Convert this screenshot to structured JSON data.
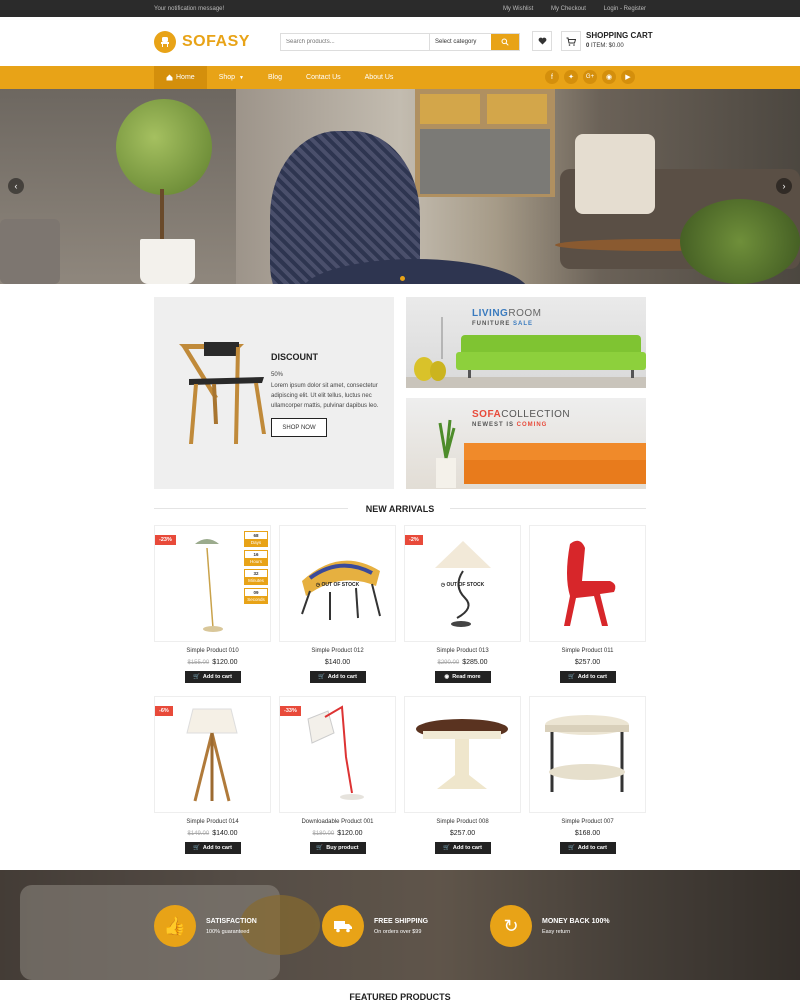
{
  "topbar": {
    "notification": "Your notification message!",
    "links": [
      "My Wishlist",
      "My Checkout",
      "Login - Register"
    ]
  },
  "logo": {
    "text": "SOFASY"
  },
  "search": {
    "placeholder": "Search products...",
    "category": "Select category"
  },
  "cart": {
    "title": "SHOPPING CART",
    "count": "0",
    "summary": "ITEM: $0.00"
  },
  "nav": {
    "items": [
      "Home",
      "Shop",
      "Blog",
      "Contact Us",
      "About Us"
    ],
    "social": [
      "f",
      "t",
      "G+",
      "ig",
      "yt"
    ]
  },
  "discount": {
    "title": "DISCOUNT",
    "percent": "50%",
    "text": "Lorem ipsum dolor sit amet, consectetur adipiscing elit. Ut elit tellus, luctus nec ullamcorper mattis, pulvinar dapibus leo.",
    "button": "SHOP NOW"
  },
  "banner1": {
    "title_a": "LIVING",
    "title_b": "ROOM",
    "sub_a": "FUNITURE ",
    "sub_b": "SALE"
  },
  "banner2": {
    "title_a": "SOFA",
    "title_b": "COLLECTION",
    "sub_a": "NEWEST IS ",
    "sub_b": "COMING"
  },
  "new_arrivals": {
    "title": "NEW ARRIVALS",
    "products": [
      {
        "name": "Simple Product 010",
        "old_price": "$155.00",
        "price": "$120.00",
        "action": "Add to cart",
        "badge": "-23%"
      },
      {
        "name": "Simple Product 012",
        "old_price": "",
        "price": "$140.00",
        "action": "Add to cart",
        "badge": "",
        "oos": "OUT OF STOCK"
      },
      {
        "name": "Simple Product 013",
        "old_price": "$290.00",
        "price": "$285.00",
        "action": "Read more",
        "badge": "-2%",
        "oos": "OUT OF STOCK"
      },
      {
        "name": "Simple Product 011",
        "old_price": "",
        "price": "$257.00",
        "action": "Add to cart",
        "badge": ""
      },
      {
        "name": "Simple Product 014",
        "old_price": "$149.00",
        "price": "$140.00",
        "action": "Add to cart",
        "badge": "-6%"
      },
      {
        "name": "Downloadable Product 001",
        "old_price": "$180.00",
        "price": "$120.00",
        "action": "Buy product",
        "badge": "-33%"
      },
      {
        "name": "Simple Product 008",
        "old_price": "",
        "price": "$257.00",
        "action": "Add to cart",
        "badge": ""
      },
      {
        "name": "Simple Product 007",
        "old_price": "",
        "price": "$168.00",
        "action": "Add to cart",
        "badge": ""
      }
    ],
    "timer": [
      {
        "value": "68",
        "unit": "Days"
      },
      {
        "value": "16",
        "unit": "Hours"
      },
      {
        "value": "32",
        "unit": "Minutes"
      },
      {
        "value": "09",
        "unit": "Seconds"
      }
    ]
  },
  "features": [
    {
      "title": "SATISFACTION",
      "desc": "100% guaranteed",
      "icon": "thumbs-up-icon"
    },
    {
      "title": "FREE SHIPPING",
      "desc": "On orders over $99",
      "icon": "truck-icon"
    },
    {
      "title": "MONEY BACK 100%",
      "desc": "Easy return",
      "icon": "refresh-icon"
    }
  ],
  "featured": {
    "title": "FEATURED PRODUCTS"
  },
  "colors": {
    "accent": "#e8a317",
    "badge": "#e84a3a",
    "dark": "#222222"
  }
}
